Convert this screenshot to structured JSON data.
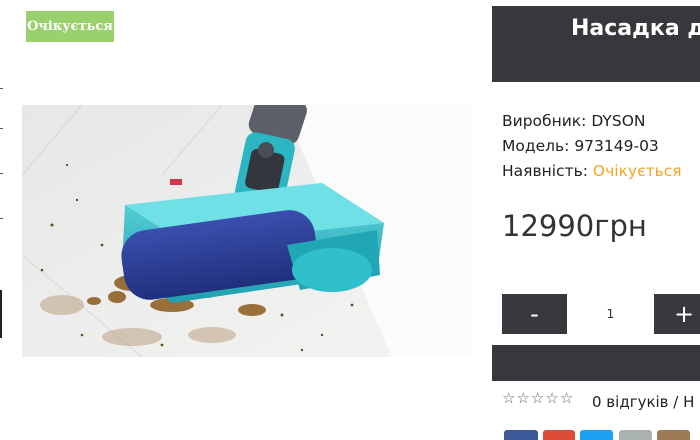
{
  "badge": {
    "label": "Очікується"
  },
  "product": {
    "title": "Насадка д",
    "manufacturer_label": "Виробник:",
    "manufacturer": "DYSON",
    "model_label": "Модель:",
    "model": "973149-03",
    "availability_label": "Наявність:",
    "availability": "Очікується",
    "price": "12990грн"
  },
  "quantity": {
    "minus": "-",
    "value": "1",
    "plus": "+"
  },
  "reviews": {
    "stars": [
      "☆",
      "☆",
      "☆",
      "☆",
      "☆"
    ],
    "text": "0 відгуків / Н"
  },
  "colors": {
    "badge": "#9bd06e",
    "dark": "#36383b",
    "availability": "#f5a623",
    "share": [
      "#3b5998",
      "#dd4b39",
      "#1da1f2",
      "#aab2b0",
      "#9c7b56"
    ]
  }
}
